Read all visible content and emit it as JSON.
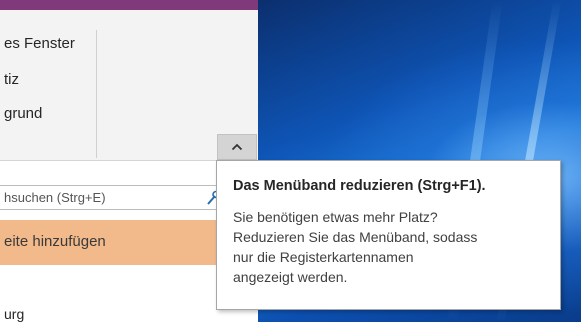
{
  "ribbon": {
    "items": [
      {
        "label": "es Fenster"
      },
      {
        "label": "tiz"
      },
      {
        "label": "grund"
      }
    ]
  },
  "collapse_button": {
    "icon": "chevron-up-icon"
  },
  "search": {
    "text": "hsuchen (Strg+E)",
    "icon": "search-icon"
  },
  "page_list": {
    "add_page_label": "eite hinzufügen",
    "items": [
      {
        "label": "urg"
      }
    ]
  },
  "tooltip": {
    "title": "Das Menüband reduzieren (Strg+F1).",
    "body_lines": [
      "Sie benötigen etwas mehr Platz?",
      "Reduzieren Sie das Menüband, sodass",
      "nur die Registerkartennamen",
      "angezeigt werden."
    ]
  },
  "colors": {
    "title_bar": "#80397b",
    "add_page_bg": "#f2b98a",
    "desktop": "#0e54b5"
  }
}
